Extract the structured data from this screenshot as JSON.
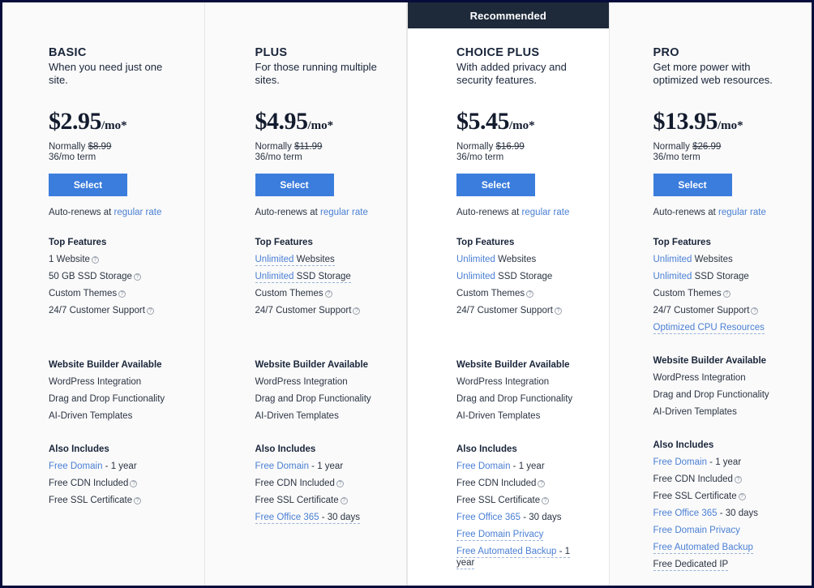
{
  "ribbon": {
    "label": "Recommended"
  },
  "common": {
    "select_label": "Select",
    "autorenew_prefix": "Auto-renews at ",
    "autorenew_link": "regular rate",
    "top_features_title": "Top Features",
    "builder_title": "Website Builder Available",
    "also_includes_title": "Also Includes",
    "normally_prefix": "Normally ",
    "term": "36/mo term",
    "per_month": "/mo*",
    "help_icon": "?",
    "accent_blue": "#3b7ddd",
    "link_blue": "#4a7fd4",
    "ribbon_bg": "#1e2a3a",
    "page_border": "#060d3a",
    "panel_bg": "#fafafa",
    "featured_bg": "#ffffff"
  },
  "plans": [
    {
      "name": "BASIC",
      "tagline": "When you need just one site.",
      "price": "$2.95",
      "normally": "$8.99",
      "featured": false,
      "top_features": [
        {
          "text": "1 Website",
          "help": true
        },
        {
          "text": "50 GB SSD Storage",
          "help": true
        },
        {
          "text": "Custom Themes",
          "help": true
        },
        {
          "text": "24/7 Customer Support",
          "help": true
        }
      ],
      "builder": [
        "WordPress Integration",
        "Drag and Drop Functionality",
        "AI-Driven Templates"
      ],
      "also_includes": [
        {
          "highlight": "Free Domain",
          "rest": " - 1 year"
        },
        {
          "text": "Free CDN Included",
          "help": true
        },
        {
          "text": "Free SSL Certificate",
          "help": true
        }
      ]
    },
    {
      "name": "PLUS",
      "tagline": "For those running multiple sites.",
      "price": "$4.95",
      "normally": "$11.99",
      "featured": false,
      "top_features": [
        {
          "highlight": "Unlimited",
          "rest": " Websites",
          "dotted": true
        },
        {
          "highlight": "Unlimited",
          "rest": " SSD Storage",
          "dotted": true
        },
        {
          "text": "Custom Themes",
          "help": true
        },
        {
          "text": "24/7 Customer Support",
          "help": true
        }
      ],
      "builder": [
        "WordPress Integration",
        "Drag and Drop Functionality",
        "AI-Driven Templates"
      ],
      "also_includes": [
        {
          "highlight": "Free Domain",
          "rest": " - 1 year"
        },
        {
          "text": "Free CDN Included",
          "help": true
        },
        {
          "text": "Free SSL Certificate",
          "help": true
        },
        {
          "highlight": "Free Office 365",
          "rest": " - 30 days",
          "dotted": true
        }
      ]
    },
    {
      "name": "CHOICE PLUS",
      "tagline": "With added privacy and security features.",
      "price": "$5.45",
      "normally": "$16.99",
      "featured": true,
      "top_features": [
        {
          "highlight": "Unlimited",
          "rest": " Websites"
        },
        {
          "highlight": "Unlimited",
          "rest": " SSD Storage"
        },
        {
          "text": "Custom Themes",
          "help": true
        },
        {
          "text": "24/7 Customer Support",
          "help": true
        }
      ],
      "builder": [
        "WordPress Integration",
        "Drag and Drop Functionality",
        "AI-Driven Templates"
      ],
      "also_includes": [
        {
          "highlight": "Free Domain",
          "rest": " - 1 year"
        },
        {
          "text": "Free CDN Included",
          "help": true
        },
        {
          "text": "Free SSL Certificate",
          "help": true
        },
        {
          "highlight": "Free Office 365",
          "rest": " - 30 days"
        },
        {
          "highlight": "Free Domain Privacy",
          "rest": "",
          "dotted": true
        },
        {
          "highlight": "Free Automated Backup",
          "rest": " - 1 year",
          "dotted": true
        }
      ]
    },
    {
      "name": "PRO",
      "tagline": "Get more power with optimized web resources.",
      "price": "$13.95",
      "normally": "$26.99",
      "featured": false,
      "top_features": [
        {
          "highlight": "Unlimited",
          "rest": " Websites"
        },
        {
          "highlight": "Unlimited",
          "rest": " SSD Storage"
        },
        {
          "text": "Custom Themes",
          "help": true
        },
        {
          "text": "24/7 Customer Support",
          "help": true
        },
        {
          "highlight": "Optimized CPU Resources",
          "rest": "",
          "dotted": true
        }
      ],
      "builder": [
        "WordPress Integration",
        "Drag and Drop Functionality",
        "AI-Driven Templates"
      ],
      "also_includes": [
        {
          "highlight": "Free Domain",
          "rest": " - 1 year"
        },
        {
          "text": "Free CDN Included",
          "help": true
        },
        {
          "text": "Free SSL Certificate",
          "help": true
        },
        {
          "highlight": "Free Office 365",
          "rest": " - 30 days"
        },
        {
          "highlight": "Free Domain Privacy",
          "rest": ""
        },
        {
          "highlight": "Free Automated Backup",
          "rest": "",
          "dotted": true
        },
        {
          "text": "Free Dedicated IP",
          "dotted": true
        }
      ]
    }
  ]
}
